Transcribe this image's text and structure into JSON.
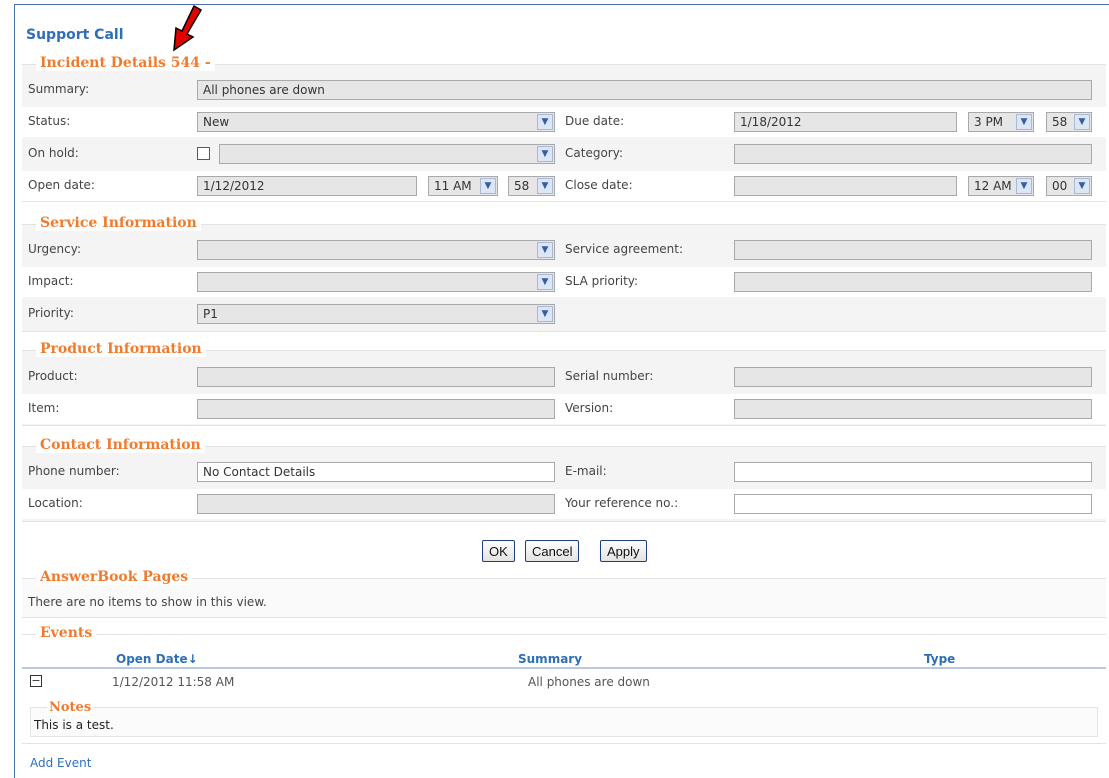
{
  "page_title": "Support Call",
  "incident": {
    "legend": "Incident Details 544 - ",
    "summary_label": "Summary:",
    "summary_value": "All phones are down",
    "status_label": "Status:",
    "status_value": "New",
    "due_date_label": "Due date:",
    "due_date_value": "1/18/2012",
    "due_hour": "3 PM",
    "due_min": "58",
    "on_hold_label": "On hold:",
    "on_hold_value": "",
    "category_label": "Category:",
    "category_value": "",
    "open_date_label": "Open date:",
    "open_date_value": "1/12/2012",
    "open_hour": "11 AM",
    "open_min": "58",
    "close_date_label": "Close date:",
    "close_date_value": "",
    "close_hour": "12 AM",
    "close_min": "00"
  },
  "service": {
    "legend": "Service Information",
    "urgency_label": "Urgency:",
    "urgency_value": "",
    "service_agreement_label": "Service agreement:",
    "service_agreement_value": "",
    "impact_label": "Impact:",
    "impact_value": "",
    "sla_priority_label": "SLA priority:",
    "sla_priority_value": "",
    "priority_label": "Priority:",
    "priority_value": "P1"
  },
  "product": {
    "legend": "Product Information",
    "product_label": "Product:",
    "product_value": "",
    "serial_label": "Serial number:",
    "serial_value": "",
    "item_label": "Item:",
    "item_value": "",
    "version_label": "Version:",
    "version_value": ""
  },
  "contact": {
    "legend": "Contact Information",
    "phone_label": "Phone number:",
    "phone_value": "No Contact Details",
    "email_label": "E-mail:",
    "email_value": "",
    "location_label": "Location:",
    "location_value": "",
    "reference_label": "Your reference no.:",
    "reference_value": ""
  },
  "buttons": {
    "ok": "OK",
    "cancel": "Cancel",
    "apply": "Apply"
  },
  "answerbook": {
    "legend": "AnswerBook Pages",
    "empty_text": "There are no items to show in this view."
  },
  "events": {
    "legend": "Events",
    "columns": {
      "open_date": "Open Date",
      "sort_glyph": "↓",
      "summary": "Summary",
      "type": "Type"
    },
    "rows": [
      {
        "expand_glyph": "−",
        "open_date": "1/12/2012 11:58 AM",
        "summary": "All phones are down",
        "type": ""
      }
    ],
    "notes_legend": "Notes",
    "notes_text": "This is a test.",
    "add_event": "Add Event"
  },
  "icons": {
    "dropdown": "chevron-down-icon",
    "annotation": "red-arrow-icon"
  },
  "colors": {
    "legend": "#f07b2d",
    "link": "#2f6fb8",
    "arrow": "#e00000"
  }
}
